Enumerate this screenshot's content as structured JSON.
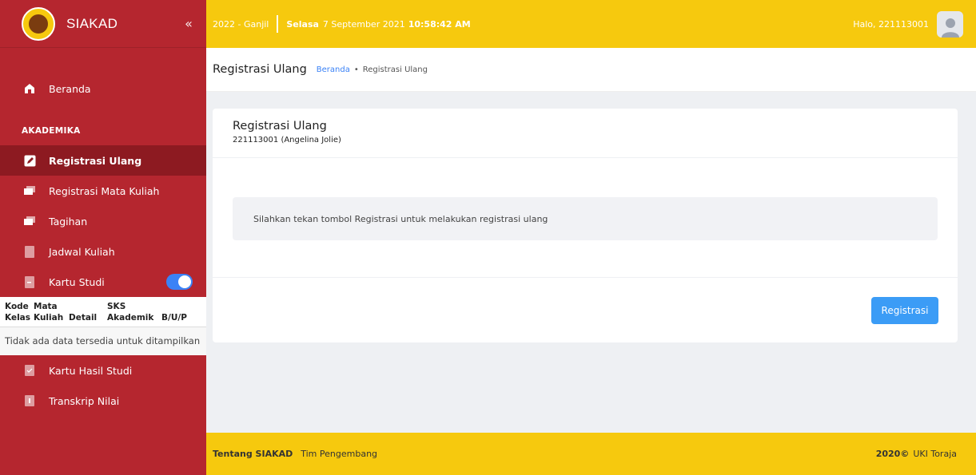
{
  "brand": {
    "name": "SIAKAD",
    "collapse_icon": "double-chevron-left-icon"
  },
  "sidebar": {
    "home": {
      "label": "Beranda",
      "icon": "home-icon"
    },
    "section": "AKADEMIKA",
    "items": [
      {
        "label": "Registrasi Ulang",
        "icon": "edit-icon",
        "active": true
      },
      {
        "label": "Registrasi Mata Kuliah",
        "icon": "chat-icon"
      },
      {
        "label": "Tagihan",
        "icon": "chat-icon"
      },
      {
        "label": "Jadwal Kuliah",
        "icon": "file-icon"
      },
      {
        "label": "Kartu Studi",
        "icon": "file-icon",
        "toggle_on": true
      }
    ],
    "ks_table": {
      "headers": [
        "Kode Kelas",
        "Mata Kuliah",
        "Detail",
        "SKS Akademik",
        "B/U/P"
      ],
      "empty": "Tidak ada data tersedia untuk ditampilkan"
    },
    "items_after": [
      {
        "label": "Kartu Hasil Studi",
        "icon": "check-file-icon"
      },
      {
        "label": "Transkrip Nilai",
        "icon": "file-icon"
      }
    ]
  },
  "topbar": {
    "semester": "2022 - Ganjil",
    "day": "Selasa",
    "date": "7 September 2021",
    "time": "10:58:42 AM",
    "greeting": "Halo, 221113001"
  },
  "page": {
    "title": "Registrasi Ulang",
    "breadcrumb": [
      "Beranda",
      "Registrasi Ulang"
    ]
  },
  "card": {
    "title": "Registrasi Ulang",
    "subtitle": "221113001 (Angelina Jolie)",
    "info": "Silahkan tekan tombol Registrasi untuk melakukan registrasi ulang",
    "button": "Registrasi"
  },
  "footer": {
    "about": "Tentang SIAKAD",
    "team": "Tim Pengembang",
    "year": "2020©",
    "org": "UKI Toraja"
  },
  "colors": {
    "sidebar": "#b5262f",
    "sidebar_active": "#8d1a21",
    "topbar": "#f6c90e",
    "button": "#3b9cf6"
  }
}
